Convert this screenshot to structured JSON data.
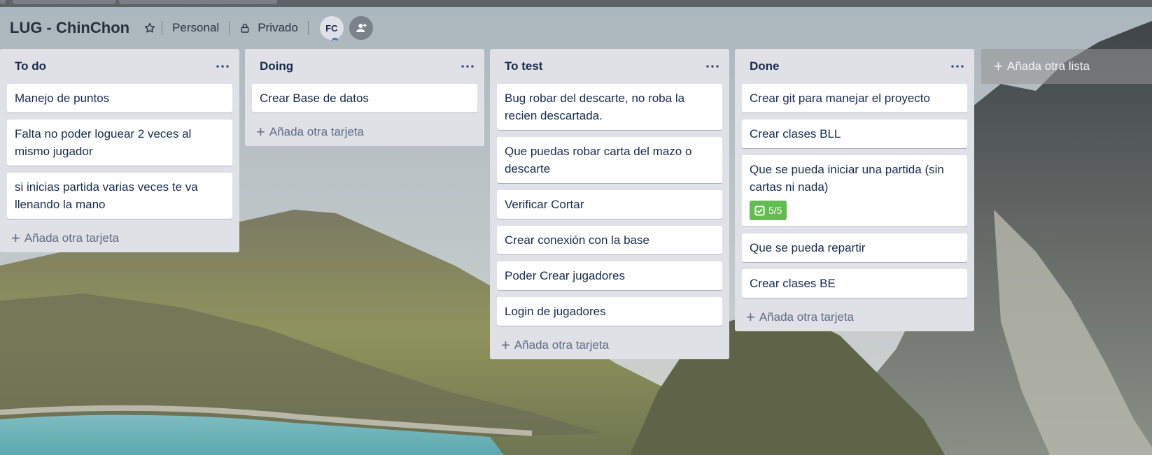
{
  "board": {
    "title": "LUG - ChinChon",
    "workspace": "Personal",
    "visibility": "Privado",
    "member_initials": "FC",
    "accent": "#0052cc"
  },
  "add_card_label": "Añada otra tarjeta",
  "add_list_label": "Añada otra lista",
  "lists": [
    {
      "title": "To do",
      "cards": [
        {
          "text": "Manejo de puntos"
        },
        {
          "text": "Falta no poder loguear 2 veces al mismo jugador"
        },
        {
          "text": "si inicias partida varias veces te va llenando la mano"
        }
      ]
    },
    {
      "title": "Doing",
      "cards": [
        {
          "text": "Crear Base de datos"
        }
      ]
    },
    {
      "title": "To test",
      "cards": [
        {
          "text": "Bug robar del descarte, no roba la recien descartada."
        },
        {
          "text": "Que puedas robar carta del mazo o descarte"
        },
        {
          "text": "Verificar Cortar"
        },
        {
          "text": "Crear conexión con la base"
        },
        {
          "text": "Poder Crear jugadores"
        },
        {
          "text": "Login de jugadores"
        }
      ]
    },
    {
      "title": "Done",
      "cards": [
        {
          "text": "Crear git para manejar el proyecto"
        },
        {
          "text": "Crear clases BLL"
        },
        {
          "text": "Que se pueda iniciar una partida (sin cartas ni nada)",
          "checklist": "5/5",
          "checklist_color": "#61bd4f"
        },
        {
          "text": "Que se pueda repartir"
        },
        {
          "text": "Crear clases BE"
        }
      ]
    }
  ]
}
